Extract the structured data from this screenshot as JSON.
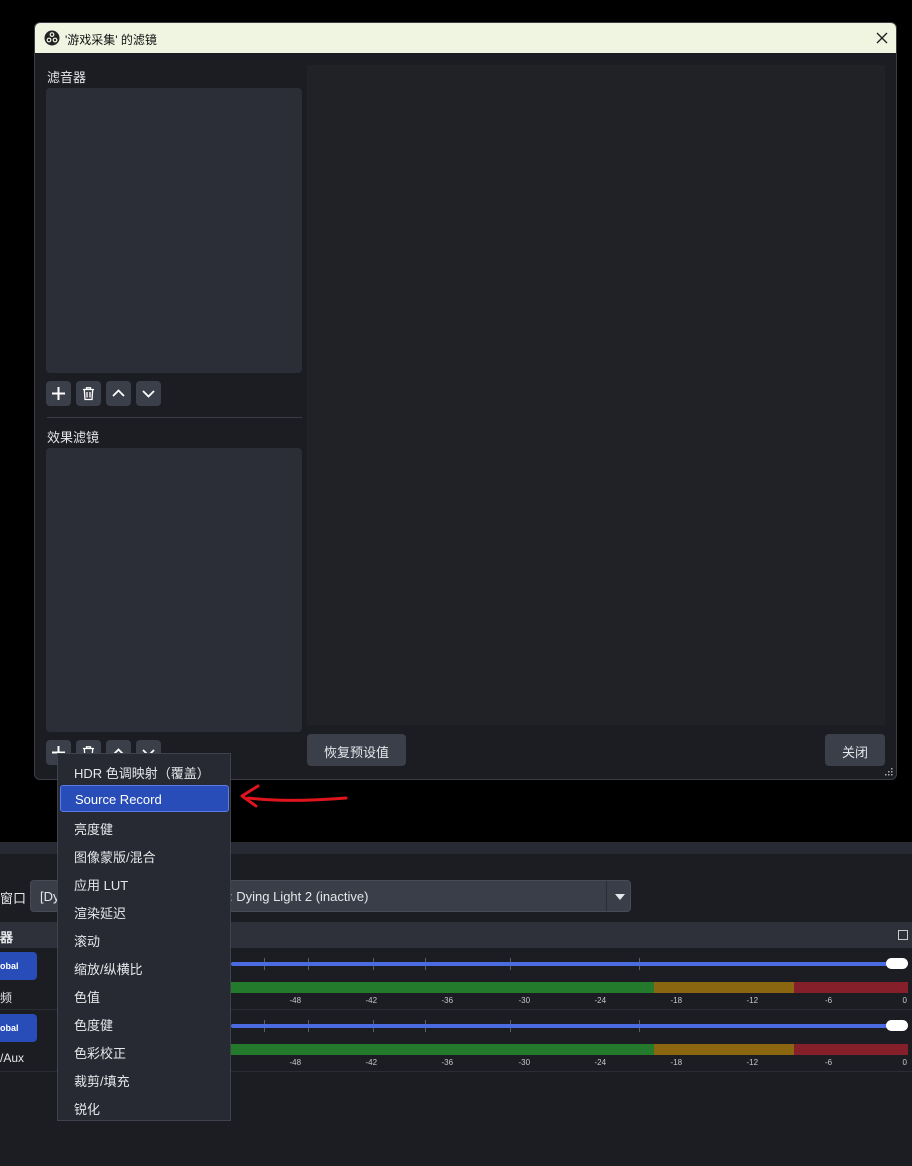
{
  "dialog": {
    "title": "'游戏采集' 的滤镜",
    "audio_filters_label": "滤音器",
    "effect_filters_label": "效果滤镜",
    "reset_button": "恢复预设值",
    "close_button": "关闭"
  },
  "context_menu": {
    "items": [
      "HDR 色调映射（覆盖）",
      "Source Record",
      "亮度健",
      "图像蒙版/混合",
      "应用 LUT",
      "渲染延迟",
      "滚动",
      "缩放/纵横比",
      "色值",
      "色度健",
      "色彩校正",
      "裁剪/填充",
      "锐化"
    ],
    "selected_item": "Source Record"
  },
  "background": {
    "window_label": "窗口",
    "source_select": {
      "value_left": "[Dy",
      "value_right": ": Dying Light 2 (inactive)"
    },
    "mixer_title": "器",
    "channels": [
      {
        "global_label": "obal",
        "name": "频",
        "volume": 1.0
      },
      {
        "global_label": "obal",
        "name": "/Aux",
        "volume": 1.0
      }
    ],
    "meter_labels": [
      "-48",
      "-42",
      "-36",
      "-30",
      "-24",
      "-18",
      "-12",
      "-6",
      "0"
    ]
  },
  "colors": {
    "accent": "#284cb8",
    "title_bar": "#f0f5e2",
    "annotation_arrow": "#e0141c",
    "meter_green": "#237a2d",
    "meter_yellow": "#8a6611",
    "meter_red": "#85202a"
  },
  "icons": {
    "app": "obs-logo-icon",
    "close": "close-icon",
    "add": "plus-icon",
    "remove": "trash-icon",
    "move_up": "chevron-up-icon",
    "move_down": "chevron-down-icon",
    "dropdown": "caret-down-icon",
    "float": "undock-icon"
  }
}
